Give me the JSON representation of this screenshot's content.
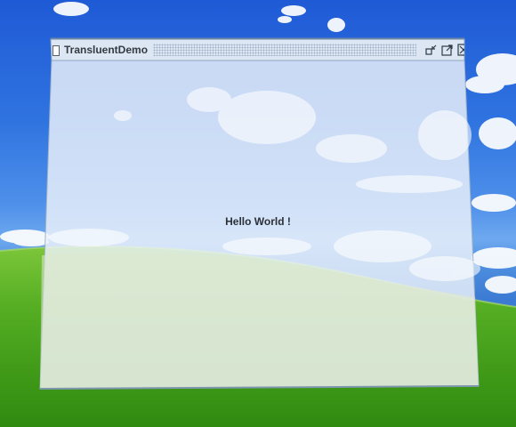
{
  "window": {
    "title": "TransluentDemo",
    "icon": "document-icon",
    "controls": [
      "minimize-icon",
      "maximize-icon",
      "close-icon"
    ]
  },
  "content": {
    "message": "Hello World !"
  },
  "colors": {
    "sky": "#2f73e0",
    "grass": "#58b52a",
    "window_tint": "#e8eef6",
    "title_text": "#333a44"
  }
}
